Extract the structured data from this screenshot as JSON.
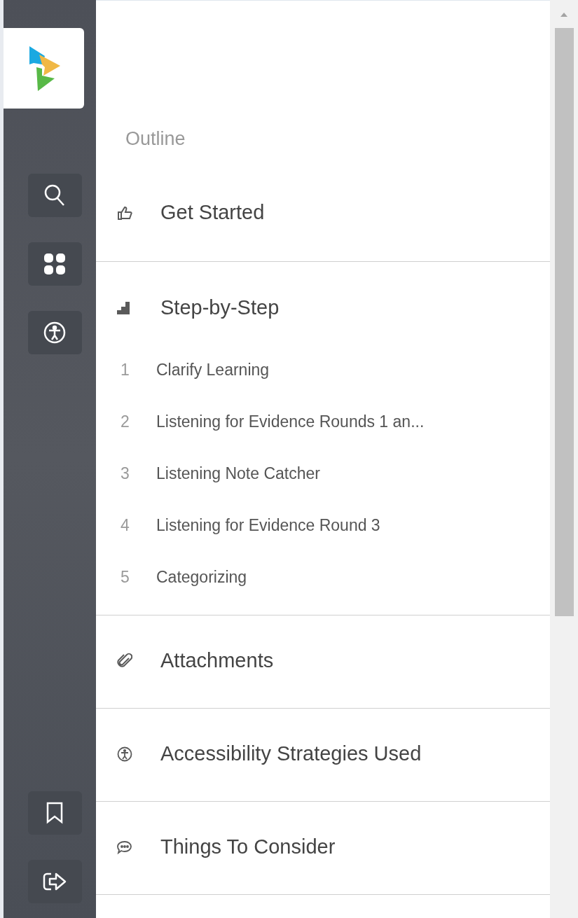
{
  "outline": {
    "title": "Outline"
  },
  "sections": [
    {
      "kind": "start",
      "title": "Get Started"
    },
    {
      "kind": "steps",
      "title": "Step-by-Step",
      "steps": [
        {
          "number": "1",
          "label": "Clarify Learning"
        },
        {
          "number": "2",
          "label": "Listening for Evidence Rounds 1 an..."
        },
        {
          "number": "3",
          "label": "Listening Note Catcher"
        },
        {
          "number": "4",
          "label": "Listening for Evidence Round 3"
        },
        {
          "number": "5",
          "label": "Categorizing"
        }
      ]
    },
    {
      "kind": "attachments",
      "title": "Attachments"
    },
    {
      "kind": "accessibility",
      "title": "Accessibility Strategies Used"
    },
    {
      "kind": "consider",
      "title": "Things To Consider"
    }
  ]
}
